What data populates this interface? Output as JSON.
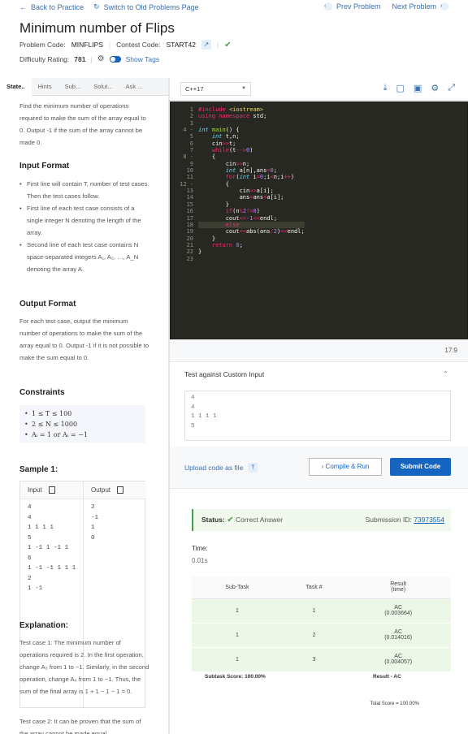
{
  "nav": {
    "back": "Back to Practice",
    "switch": "Switch to Old Problems Page",
    "prev": "Prev Problem",
    "next": "Next Problem"
  },
  "problem": {
    "title": "Minimum number of Flips",
    "code_label": "Problem Code:",
    "code": "MINFLIPS",
    "contest_label": "Contest Code:",
    "contest": "START42",
    "difficulty_label": "Difficulty Rating:",
    "difficulty": "781",
    "show_tags": "Show Tags"
  },
  "tabs": [
    "State..",
    "Hints",
    "Sub...",
    "Solut...",
    "Ask ..."
  ],
  "statement": {
    "intro": "Find the minimum number of operations required to make the sum of the array equal to 0. Output -1 if the sum of the array cannot be made 0.",
    "input_heading": "Input Format",
    "input_items": [
      "First line will contain T, number of test cases. Then the test cases follow.",
      "First line of each test case consists of a single integer N denoting the length of the array.",
      "Second line of each test case contains N space-separated integers A₁, A₂, …, A_N denoting the array A."
    ],
    "output_heading": "Output Format",
    "output_text": "For each test case, output the minimum number of operations to make the sum of the array equal to 0. Output -1 if it is not possible to make the sum equal to 0.",
    "constraints_heading": "Constraints",
    "constraints": [
      "1 ≤ T ≤ 100",
      "2 ≤ N ≤ 1000",
      "Aᵢ = 1  or  Aᵢ = −1"
    ],
    "sample_heading": "Sample 1:",
    "input_col": "Input",
    "output_col": "Output",
    "sample_input": "4\n4\n1 1 1 1\n5\n1 -1 1 -1 1\n6\n1 -1 -1 1 1 1\n2\n1 -1",
    "sample_output": "2\n-1\n1\n0",
    "explanation_heading": "Explanation:",
    "explanation": "Test case 1: The minimum number of operations required is 2. In the first operation, change A₃ from 1 to −1. Similarly, in the second operation, change A₄ from 1 to −1. Thus, the sum of the final array is 1 + 1 − 1 − 1 = 0.",
    "explanation2": "Test case 2: It can be proven that the sum of the array cannot be made equal"
  },
  "editor": {
    "language": "C++17",
    "cursor": "17:9",
    "line_numbers": [
      "1",
      "2",
      "3",
      "4 -",
      "5",
      "6",
      "7",
      "8 -",
      "9",
      "10",
      "11",
      "12 -",
      "13",
      "14",
      "15",
      "16",
      "17",
      "18",
      "19",
      "20",
      "21",
      "22",
      "23"
    ]
  },
  "custom": {
    "title": "Test against Custom Input",
    "input": "4\n4\n1 1 1 1\n5"
  },
  "actions": {
    "upload": "Upload code as file",
    "compile": "Compile & Run",
    "submit": "Submit Code"
  },
  "result": {
    "status_label": "Status:",
    "status": "Correct Answer",
    "submission_label": "Submission ID:",
    "submission_id": "73973554",
    "time_label": "Time:",
    "time": "0.01s",
    "columns": [
      "Sub-Task",
      "Task #",
      "Result\n(time)"
    ],
    "rows": [
      {
        "subtask": "1",
        "task": "1",
        "verdict": "AC",
        "time": "(0.003664)"
      },
      {
        "subtask": "1",
        "task": "2",
        "verdict": "AC",
        "time": "(0.014016)"
      },
      {
        "subtask": "1",
        "task": "3",
        "verdict": "AC",
        "time": "(0.004057)"
      }
    ],
    "subtask_score": "Subtask Score: 100.00%",
    "result_ac": "Result - AC",
    "total_score": "Total Score = 100.00%"
  }
}
